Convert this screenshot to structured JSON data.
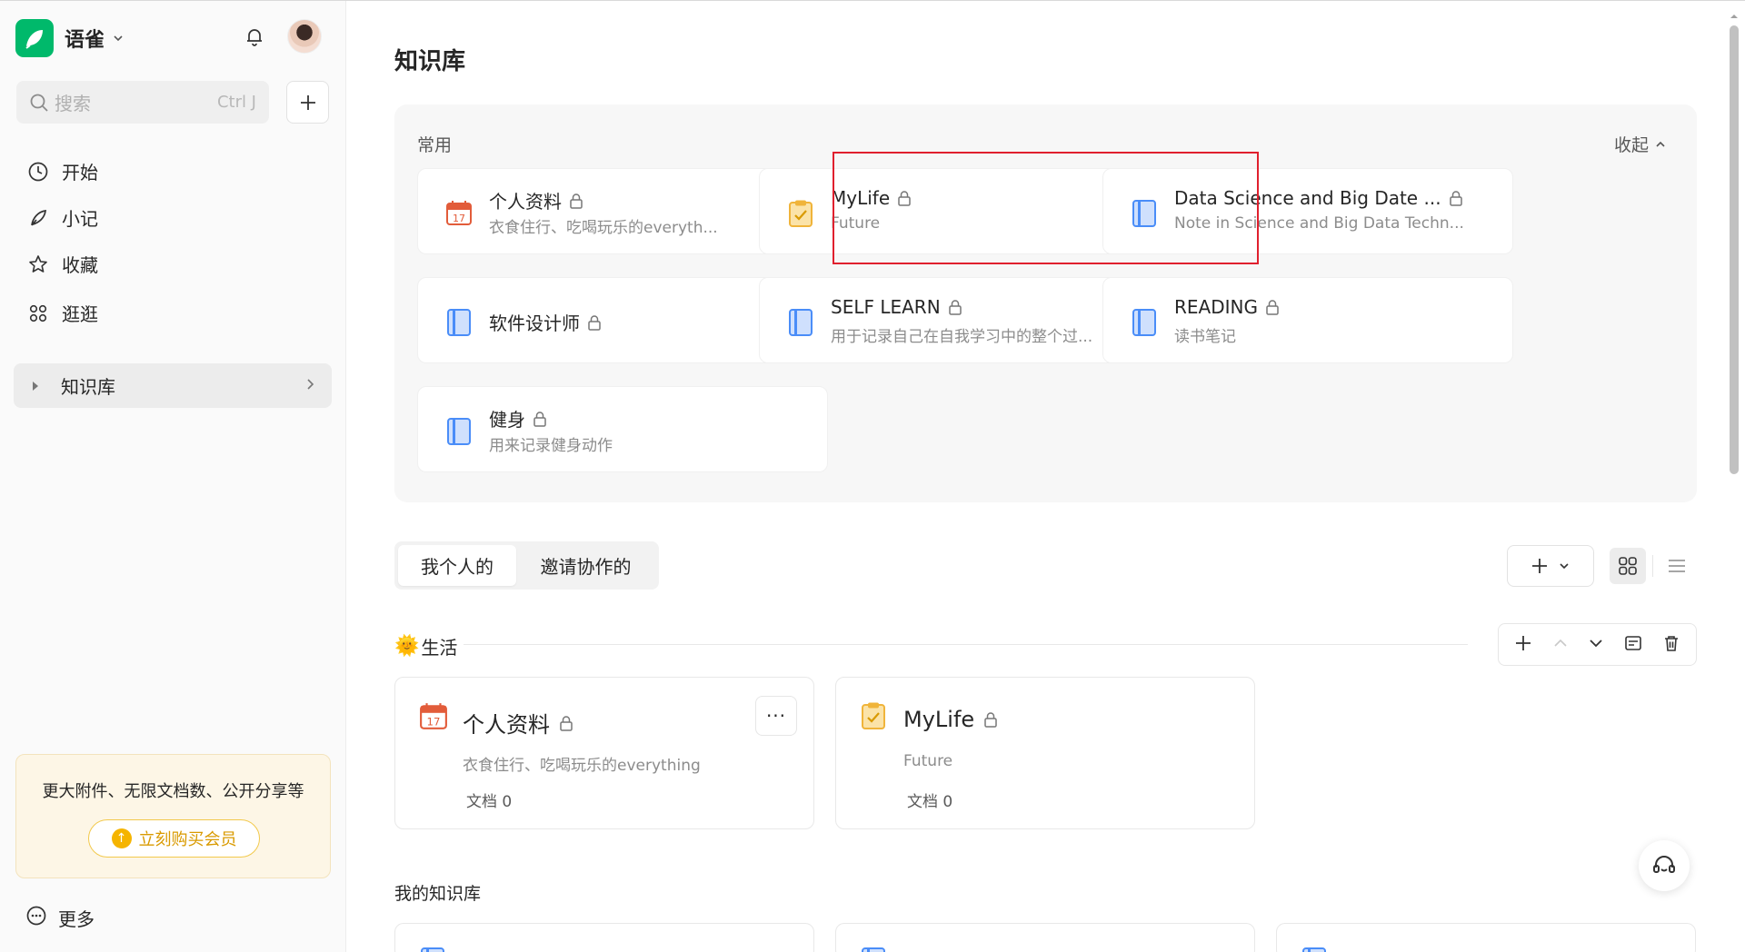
{
  "app": {
    "name": "语雀"
  },
  "search": {
    "placeholder": "搜索",
    "shortcut": "Ctrl J"
  },
  "sidebar": {
    "nav": [
      {
        "label": "开始",
        "icon": "clock-icon"
      },
      {
        "label": "小记",
        "icon": "pen-icon"
      },
      {
        "label": "收藏",
        "icon": "star-icon"
      },
      {
        "label": "逛逛",
        "icon": "grid-icon"
      }
    ],
    "knowledge_base": "知识库",
    "promo": {
      "text": "更大附件、无限文档数、公开分享等",
      "button": "立刻购买会员"
    },
    "more": "更多"
  },
  "main": {
    "title": "知识库",
    "common": {
      "label": "常用",
      "collapse": "收起",
      "items": [
        {
          "title": "个人资料",
          "subtitle": "衣食住行、吃喝玩乐的everyth...",
          "icon": "calendar-icon"
        },
        {
          "title": "MyLife",
          "subtitle": "Future",
          "icon": "clipboard-icon"
        },
        {
          "title": "Data Science and Big Date ...",
          "subtitle": "Note in Science and Big Data Techn...",
          "icon": "book-icon"
        },
        {
          "title": "软件设计师",
          "subtitle": "",
          "icon": "book-icon"
        },
        {
          "title": "SELF LEARN",
          "subtitle": "用于记录自己在自我学习中的整个过...",
          "icon": "book-icon"
        },
        {
          "title": "READING",
          "subtitle": "读书笔记",
          "icon": "book-icon"
        },
        {
          "title": "健身",
          "subtitle": "用来记录健身动作",
          "icon": "book-icon"
        }
      ]
    },
    "tabs": [
      "我个人的",
      "邀请协作的"
    ],
    "group": {
      "name": "生活",
      "emoji": "🌞",
      "books": [
        {
          "title": "个人资料",
          "desc": "衣食住行、吃喝玩乐的everything",
          "count": "文档 0",
          "icon": "calendar-icon"
        },
        {
          "title": "MyLife",
          "desc": "Future",
          "count": "文档 0",
          "icon": "clipboard-icon"
        }
      ]
    },
    "my_kb_label": "我的知识库",
    "more_dots": "···"
  },
  "colors": {
    "brand": "#00b96b",
    "highlight": "#e0202e",
    "book_blue": "#4a8df8",
    "calendar_red": "#e25c3a",
    "clipboard_yellow": "#f0b43a"
  }
}
